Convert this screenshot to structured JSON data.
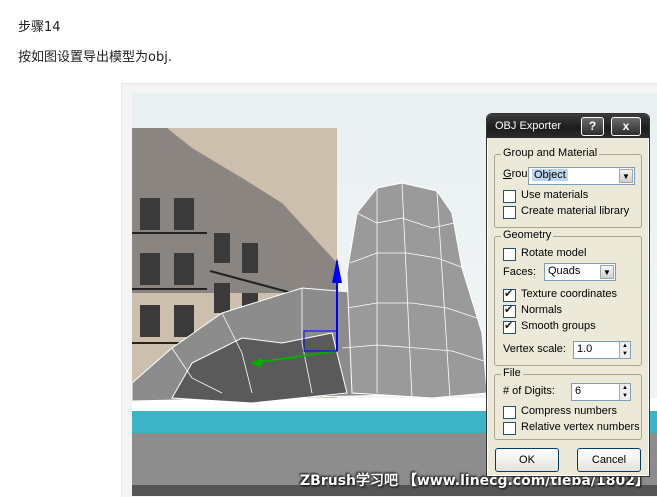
{
  "article": {
    "step_title": "步骤14",
    "description": "按如图设置导出模型为obj."
  },
  "watermark": "ZBrush学习吧 【www.linecg.com/tieba/1802】",
  "dialog": {
    "title": "OBJ Exporter",
    "help_button": "?",
    "close_button": "x",
    "group_material": {
      "label": "Group and Material",
      "group_by_label": "Group by:",
      "group_by_value": "Object",
      "use_materials": {
        "label": "Use materials",
        "checked": false
      },
      "create_material_library": {
        "label": "Create material library",
        "checked": false
      }
    },
    "geometry": {
      "label": "Geometry",
      "rotate_model": {
        "label": "Rotate model",
        "checked": false
      },
      "faces_label": "Faces:",
      "faces_value": "Quads",
      "texture_coordinates": {
        "label": "Texture coordinates",
        "checked": true
      },
      "normals": {
        "label": "Normals",
        "checked": true
      },
      "smooth_groups": {
        "label": "Smooth groups",
        "checked": true
      },
      "vertex_scale_label": "Vertex scale:",
      "vertex_scale_value": "1.0"
    },
    "file": {
      "label": "File",
      "digits_label": "# of Digits:",
      "digits_value": "6",
      "compress_numbers": {
        "label": "Compress numbers",
        "checked": false
      },
      "relative_vertex_numbers": {
        "label": "Relative vertex numbers",
        "checked": false
      }
    },
    "ok_button": "OK",
    "cancel_button": "Cancel"
  },
  "colors": {
    "sky": "#eef3f4",
    "model_gray": "#7f7f7f",
    "water": "#3cb4c8",
    "axis_z": "#0000ff",
    "axis_x": "#00b000"
  }
}
